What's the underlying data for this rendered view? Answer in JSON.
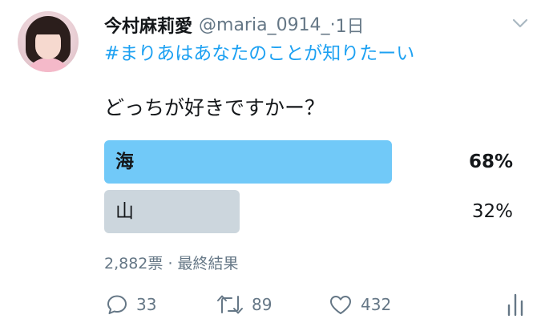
{
  "tweet": {
    "author_name": "今村麻莉愛",
    "handle": "@maria_0914_",
    "separator": "·",
    "time": "1日",
    "hashtag": "#まりあはあなたのことが知りたーい",
    "text": "どっちが好きですかー？"
  },
  "poll": {
    "options": [
      {
        "label": "海",
        "percent_text": "68%",
        "percent": 68
      },
      {
        "label": "山",
        "percent_text": "32%",
        "percent": 32
      }
    ],
    "votes_text": "2,882票",
    "meta_separator": "·",
    "status_text": "最終結果"
  },
  "actions": {
    "reply_count": "33",
    "retweet_count": "89",
    "like_count": "432"
  },
  "colors": {
    "winner_bar": "#71c9f8",
    "loser_bar": "#ccd6dd",
    "link": "#1da1f2",
    "secondary_text": "#657786"
  },
  "icons": [
    "chevron-down-icon",
    "reply-icon",
    "retweet-icon",
    "like-icon",
    "analytics-icon"
  ]
}
